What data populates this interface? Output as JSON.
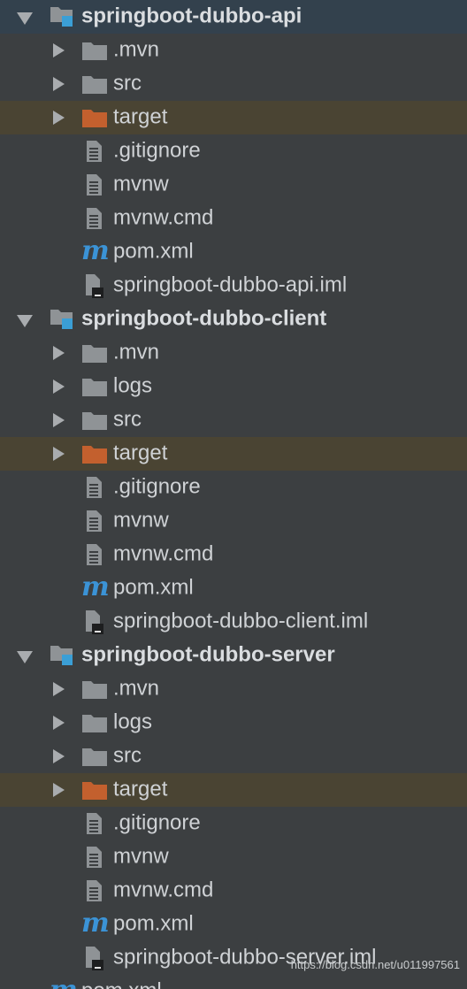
{
  "colors": {
    "background": "#3c3f41",
    "selected_row": "#33414d",
    "excluded_row": "#4a4433",
    "folder": "#8f9396",
    "excluded_folder": "#c3602e",
    "module_badge": "#3b9fd6",
    "maven_icon": "#3b93d6",
    "text": "#cfd2d5"
  },
  "tree": [
    {
      "kind": "module",
      "label": "springboot-dubbo-api",
      "selected": true
    },
    {
      "kind": "folder",
      "label": ".mvn"
    },
    {
      "kind": "folder",
      "label": "src"
    },
    {
      "kind": "excluded-folder",
      "label": "target"
    },
    {
      "kind": "file",
      "label": ".gitignore"
    },
    {
      "kind": "file",
      "label": "mvnw"
    },
    {
      "kind": "file",
      "label": "mvnw.cmd"
    },
    {
      "kind": "maven",
      "label": "pom.xml",
      "icon": "m"
    },
    {
      "kind": "iml",
      "label": "springboot-dubbo-api.iml"
    },
    {
      "kind": "module",
      "label": "springboot-dubbo-client"
    },
    {
      "kind": "folder",
      "label": ".mvn"
    },
    {
      "kind": "folder",
      "label": "logs"
    },
    {
      "kind": "folder",
      "label": "src"
    },
    {
      "kind": "excluded-folder",
      "label": "target"
    },
    {
      "kind": "file",
      "label": ".gitignore"
    },
    {
      "kind": "file",
      "label": "mvnw"
    },
    {
      "kind": "file",
      "label": "mvnw.cmd"
    },
    {
      "kind": "maven",
      "label": "pom.xml",
      "icon": "m"
    },
    {
      "kind": "iml",
      "label": "springboot-dubbo-client.iml"
    },
    {
      "kind": "module",
      "label": "springboot-dubbo-server"
    },
    {
      "kind": "folder",
      "label": ".mvn"
    },
    {
      "kind": "folder",
      "label": "logs"
    },
    {
      "kind": "folder",
      "label": "src"
    },
    {
      "kind": "excluded-folder",
      "label": "target"
    },
    {
      "kind": "file",
      "label": ".gitignore"
    },
    {
      "kind": "file",
      "label": "mvnw"
    },
    {
      "kind": "file",
      "label": "mvnw.cmd"
    },
    {
      "kind": "maven",
      "label": "pom.xml",
      "icon": "m"
    },
    {
      "kind": "iml",
      "label": "springboot-dubbo-server.iml"
    },
    {
      "kind": "maven-root",
      "label": "pom.xml",
      "icon": "m"
    }
  ],
  "watermark": "https://blog.csdn.net/u011997561"
}
